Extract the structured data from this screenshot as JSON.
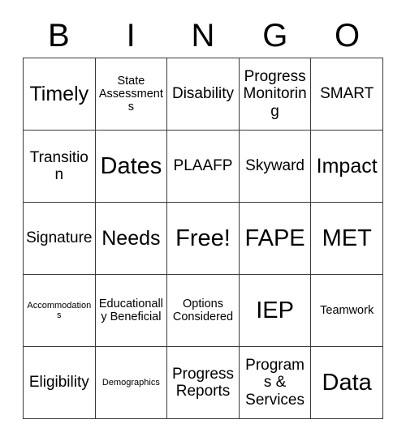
{
  "card": {
    "title": "BINGO",
    "headers": [
      "B",
      "I",
      "N",
      "G",
      "O"
    ],
    "free_space_label": "Free!",
    "colors": {
      "border": "#3a3a3a",
      "background": "#ffffff",
      "text": "#000000"
    },
    "rows": [
      [
        {
          "label": "Timely",
          "size": "lg"
        },
        {
          "label": "State Assessments",
          "size": "sm"
        },
        {
          "label": "Disability",
          "size": "md"
        },
        {
          "label": "Progress Monitoring",
          "size": "md"
        },
        {
          "label": "SMART",
          "size": "md"
        }
      ],
      [
        {
          "label": "Transition",
          "size": "md"
        },
        {
          "label": "Dates",
          "size": "xl"
        },
        {
          "label": "PLAAFP",
          "size": "md"
        },
        {
          "label": "Skyward",
          "size": "md"
        },
        {
          "label": "Impact",
          "size": "lg"
        }
      ],
      [
        {
          "label": "Signature",
          "size": "md"
        },
        {
          "label": "Needs",
          "size": "lg"
        },
        {
          "label": "Free!",
          "size": "xl"
        },
        {
          "label": "FAPE",
          "size": "xl"
        },
        {
          "label": "MET",
          "size": "xl"
        }
      ],
      [
        {
          "label": "Accommodations",
          "size": "xs"
        },
        {
          "label": "Educationally Beneficial",
          "size": "sm"
        },
        {
          "label": "Options Considered",
          "size": "sm"
        },
        {
          "label": "IEP",
          "size": "xl"
        },
        {
          "label": "Teamwork",
          "size": "sm"
        }
      ],
      [
        {
          "label": "Eligibility",
          "size": "md"
        },
        {
          "label": "Demographics",
          "size": "xs"
        },
        {
          "label": "Progress Reports",
          "size": "md"
        },
        {
          "label": "Programs & Services",
          "size": "md"
        },
        {
          "label": "Data",
          "size": "xl"
        }
      ]
    ]
  }
}
